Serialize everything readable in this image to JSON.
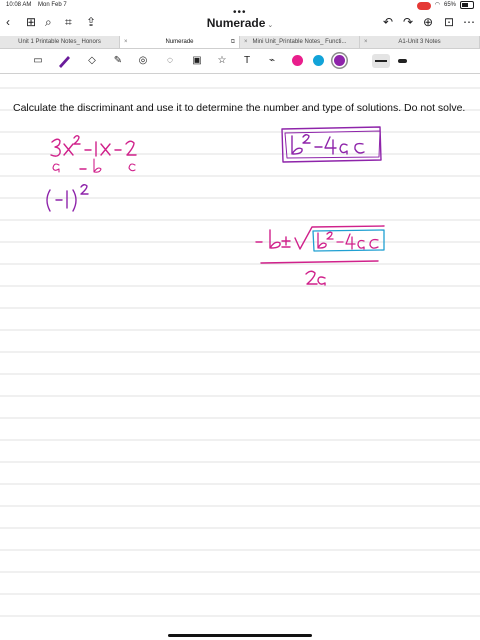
{
  "status": {
    "time": "10:08 AM",
    "date": "Mon Feb 7",
    "battery": "65%"
  },
  "nav": {
    "title": "Numerade"
  },
  "tabs": [
    {
      "label": "Unit 1 Printable Notes_ Honors"
    },
    {
      "label": "Numerade"
    },
    {
      "label": "Mini Unit_Printable Notes_ Functi..."
    },
    {
      "label": "A1-Unit 3 Notes"
    }
  ],
  "toolbar": {
    "icons": [
      "read-mode-icon",
      "pen-icon",
      "eraser-icon",
      "highlighter-icon",
      "shapes-icon",
      "lasso-icon",
      "image-icon",
      "text-icon",
      "laser-pointer-icon"
    ],
    "colors": [
      "#e91e8c",
      "#12a3d8",
      "#8e24aa"
    ],
    "selected_color": "#8e24aa"
  },
  "page": {
    "question": "Calculate the discriminant and use it to determine the number and type of solutions. Do not solve.",
    "handwriting": {
      "equation": "3x² - 1x - 2",
      "coeff_labels": [
        "a",
        "b",
        "c"
      ],
      "b_squared": "(-1)²",
      "boxed_formula": "b² - 4ac",
      "quadratic_numerator": "-b ± √(b² - 4ac)",
      "quadratic_denominator": "2a",
      "ink_colors": {
        "magenta": "#d0218b",
        "purple": "#8e24aa",
        "cyan": "#21a0d2"
      }
    }
  }
}
